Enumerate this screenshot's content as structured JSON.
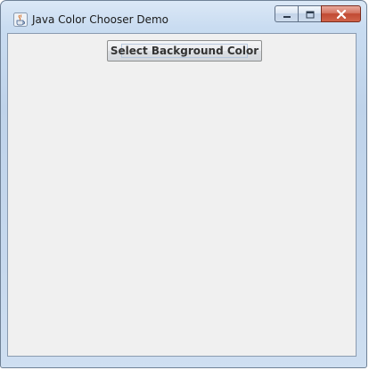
{
  "window": {
    "title": "Java Color Chooser Demo",
    "icon": "java-cup-icon",
    "controls": [
      "minimize-icon",
      "maximize-icon",
      "close-icon"
    ]
  },
  "main": {
    "button_label": "Select Background Color",
    "background_color": "#f0f0f0"
  },
  "colors": {
    "titlebar": "#c9dcf1",
    "close_button": "#c14a33",
    "panel": "#f0f0f0"
  }
}
